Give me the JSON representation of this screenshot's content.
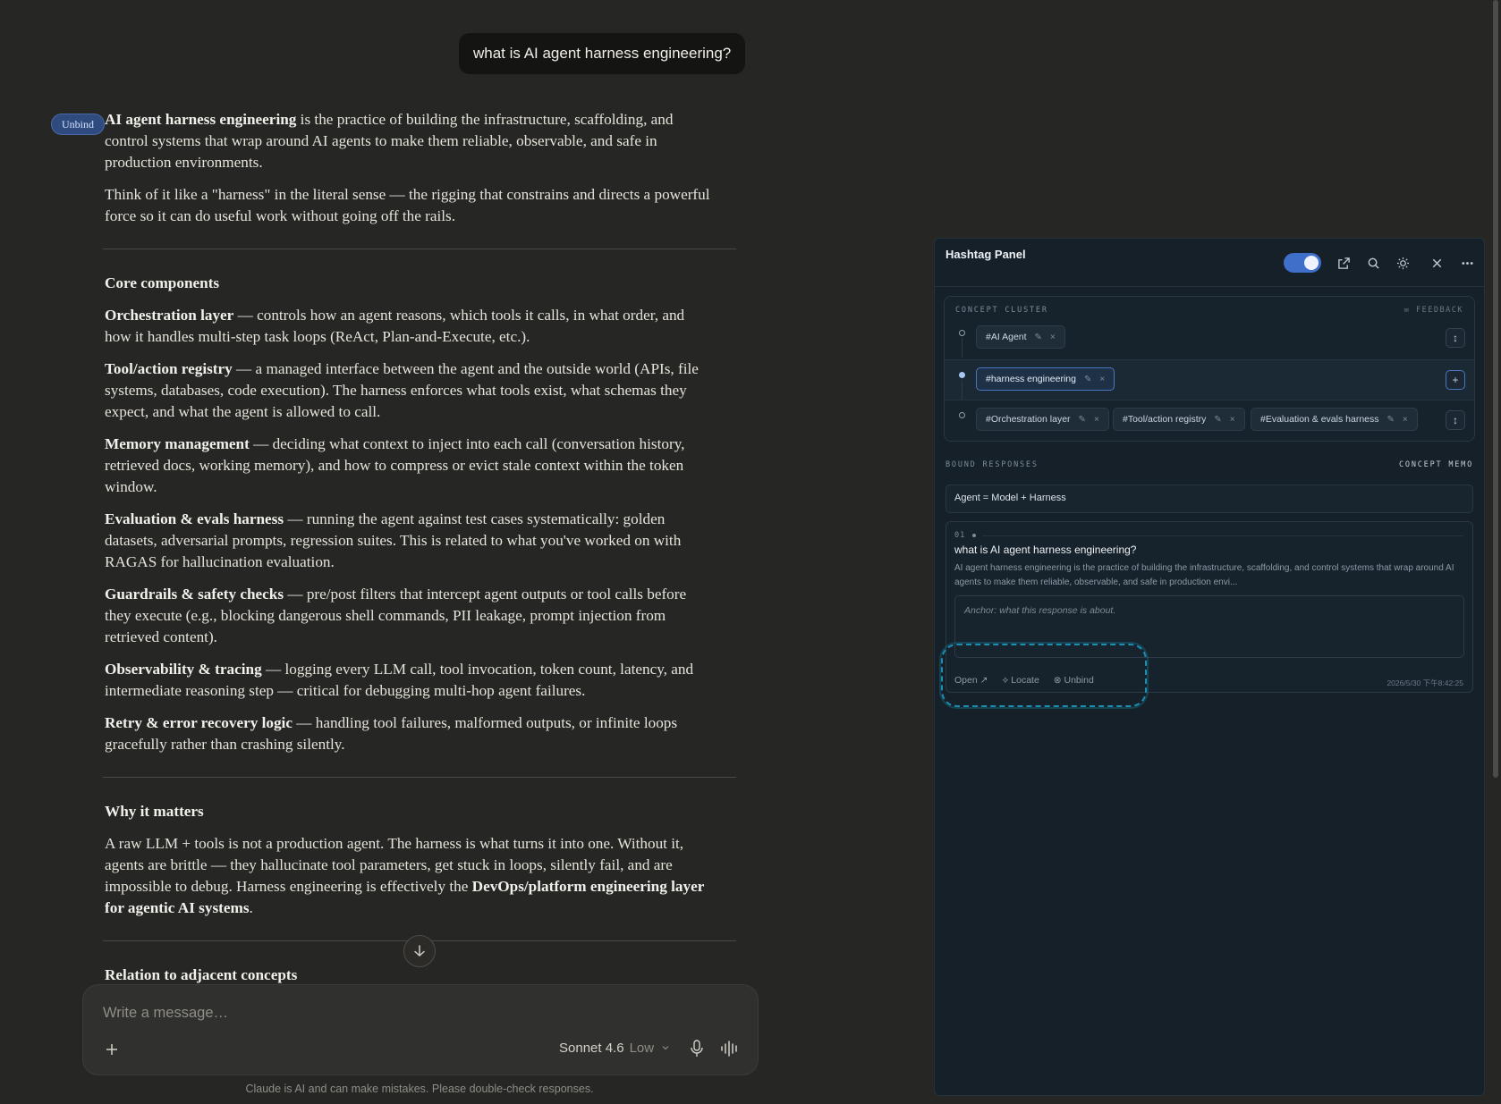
{
  "chat": {
    "user_message": "what is AI agent harness engineering?",
    "unbind_chip": "Unbind",
    "intro_bold": "AI agent harness engineering",
    "intro_rest": " is the practice of building the infrastructure, scaffolding, and control systems that wrap around AI agents to make them reliable, observable, and safe in production environments.",
    "analogy": "Think of it like a \"harness\" in the literal sense — the rigging that constrains and directs a powerful force so it can do useful work without going off the rails.",
    "section1_title": "Core components",
    "components": [
      {
        "term": "Orchestration layer",
        "desc": " — controls how an agent reasons, which tools it calls, in what order, and how it handles multi-step task loops (ReAct, Plan-and-Execute, etc.)."
      },
      {
        "term": "Tool/action registry",
        "desc": " — a managed interface between the agent and the outside world (APIs, file systems, databases, code execution). The harness enforces what tools exist, what schemas they expect, and what the agent is allowed to call."
      },
      {
        "term": "Memory management",
        "desc": " — deciding what context to inject into each call (conversation history, retrieved docs, working memory), and how to compress or evict stale context within the token window."
      },
      {
        "term": "Evaluation & evals harness",
        "desc": " — running the agent against test cases systematically: golden datasets, adversarial prompts, regression suites. This is related to what you've worked on with RAGAS for hallucination evaluation."
      },
      {
        "term": "Guardrails & safety checks",
        "desc": " — pre/post filters that intercept agent outputs or tool calls before they execute (e.g., blocking dangerous shell commands, PII leakage, prompt injection from retrieved content)."
      },
      {
        "term": "Observability & tracing",
        "desc": " — logging every LLM call, tool invocation, token count, latency, and intermediate reasoning step — critical for debugging multi-hop agent failures."
      },
      {
        "term": "Retry & error recovery logic",
        "desc": " — handling tool failures, malformed outputs, or infinite loops gracefully rather than crashing silently."
      }
    ],
    "section2_title": "Why it matters",
    "why_text": "A raw LLM + tools is not a production agent. The harness is what turns it into one. Without it, agents are brittle — they hallucinate tool parameters, get stuck in loops, silently fail, and are impossible to debug. Harness engineering is effectively the ",
    "why_bold": "DevOps/platform engineering layer for agentic AI systems",
    "why_end": ".",
    "section3_title": "Relation to adjacent concepts",
    "composer_placeholder": "Write a message…",
    "model_name": "Sonnet 4.6",
    "model_effort": "Low",
    "disclaimer": "Claude is AI and can make mistakes. Please double-check responses."
  },
  "panel": {
    "title": "Hashtag Panel",
    "toggle_on": true,
    "cluster_label": "CONCEPT CLUSTER",
    "feedback_label": "FEEDBACK",
    "rows": [
      {
        "tags": [
          "#AI Agent"
        ],
        "button": "↕"
      },
      {
        "tags": [
          "#harness engineering"
        ],
        "button": "+"
      },
      {
        "tags": [
          "#Orchestration layer",
          "#Tool/action registry",
          "#Evaluation & evals harness"
        ],
        "button": "↕"
      }
    ],
    "bound_label": "BOUND RESPONSES",
    "memo_label": "CONCEPT MEMO",
    "memo_value": "Agent = Model + Harness",
    "response": {
      "number": "01",
      "question": "what is AI agent harness engineering?",
      "excerpt": "AI agent harness engineering is the practice of building the infrastructure, scaffolding, and control systems that wrap around AI agents to make them reliable, observable, and safe in production envi...",
      "anchor_placeholder": "Anchor: what this response is about.",
      "open_label": "Open ↗",
      "locate_label": "⟡ Locate",
      "unbind_label": "⊗ Unbind",
      "timestamp": "2026/5/30 下午8:42:25"
    },
    "accent_color": "#3e70c9",
    "highlight_color": "#1c8eb0"
  }
}
